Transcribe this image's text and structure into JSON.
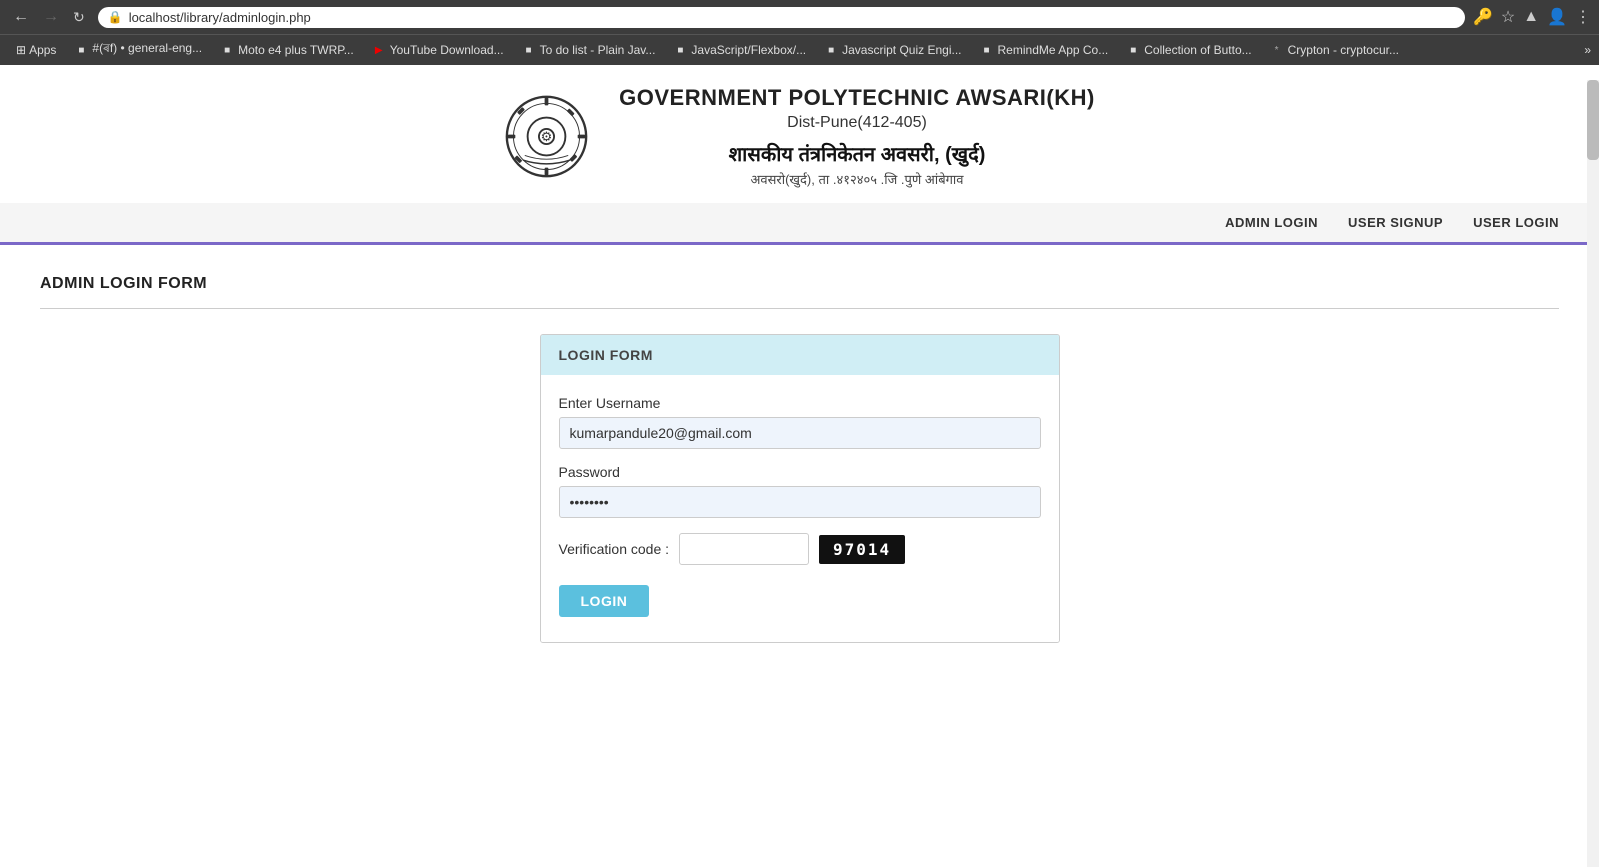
{
  "browser": {
    "url": "localhost/library/adminlogin.php",
    "back_disabled": false,
    "forward_disabled": true
  },
  "bookmarks": {
    "apps_label": "Apps",
    "items": [
      {
        "id": "bk1",
        "label": "#(ৰf) • general-eng...",
        "favicon": "★"
      },
      {
        "id": "bk2",
        "label": "Moto e4 plus TWRP...",
        "favicon": "M"
      },
      {
        "id": "bk3",
        "label": "YouTube Download...",
        "favicon": "▶"
      },
      {
        "id": "bk4",
        "label": "To do list - Plain Jav...",
        "favicon": "✓"
      },
      {
        "id": "bk5",
        "label": "JavaScript/Flexbox/...",
        "favicon": "J"
      },
      {
        "id": "bk6",
        "label": "Javascript Quiz Engi...",
        "favicon": "J"
      },
      {
        "id": "bk7",
        "label": "RemindMe App Co...",
        "favicon": "R"
      },
      {
        "id": "bk8",
        "label": "Collection of Butto...",
        "favicon": "C"
      },
      {
        "id": "bk9",
        "label": "Crypton - cryptocur...",
        "favicon": "₿"
      }
    ],
    "more_label": "»"
  },
  "header": {
    "title_en": "GOVERNMENT POLYTECHNIC AWSARI(KH)",
    "subtitle_en": "Dist-Pune(412-405)",
    "title_mr": "शासकीय तंत्रनिकेतन अवसरी, (खुर्द)",
    "subtitle_mr": "अवसरो(खुर्द), ता .४१२४०५ .जि .पुणे  आंबेगाव"
  },
  "nav": {
    "admin_login": "ADMIN LOGIN",
    "user_signup": "USER SIGNUP",
    "user_login": "USER LOGIN"
  },
  "page": {
    "form_title": "ADMIN LOGIN FORM"
  },
  "login_form": {
    "card_header": "LOGIN FORM",
    "username_label": "Enter Username",
    "username_value": "kumarpandule20@gmail.com",
    "password_label": "Password",
    "password_value": "••••••••",
    "verification_label": "Verification code :",
    "verification_input_placeholder": "",
    "verification_code": "97014",
    "login_button": "LOGIN"
  }
}
